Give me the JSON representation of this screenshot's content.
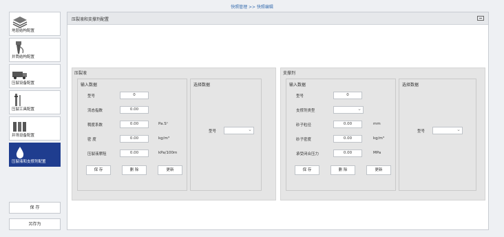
{
  "breadcrumb": "快照管理 >> 快照编辑",
  "sidebar": {
    "items": [
      {
        "label": "地层结构配置",
        "icon": "layers-icon"
      },
      {
        "label": "井筒结构配置",
        "icon": "wellbore-icon"
      },
      {
        "label": "压裂设备配置",
        "icon": "truck-icon"
      },
      {
        "label": "压裂工具配置",
        "icon": "tool-icon"
      },
      {
        "label": "井场设备配置",
        "icon": "tanks-icon"
      },
      {
        "label": "压裂液和支撑剂配置",
        "icon": "droplet-icon"
      }
    ],
    "save_label": "保 存",
    "save_as_label": "另存为"
  },
  "main": {
    "title": "压裂液和支撑剂配置"
  },
  "fluid": {
    "title": "压裂液",
    "input_title": "输入数据",
    "select_title": "选择数据",
    "rows": [
      {
        "label": "型号",
        "value": "0",
        "unit": ""
      },
      {
        "label": "流态指数",
        "value": "0.00",
        "unit": ""
      },
      {
        "label": "稠度系数",
        "value": "0.00",
        "unit": "Pa.Sⁿ"
      },
      {
        "label": "密 度",
        "value": "0.00",
        "unit": "kg/m³"
      },
      {
        "label": "压裂液摩阻",
        "value": "0.00",
        "unit": "kPa/100m"
      }
    ],
    "select_label": "型号",
    "buttons": {
      "save": "保 存",
      "delete": "删 除",
      "update": "更新"
    }
  },
  "proppant": {
    "title": "支撑剂",
    "input_title": "输入数据",
    "select_title": "选择数据",
    "rows": [
      {
        "label": "型号",
        "value": "0",
        "unit": ""
      },
      {
        "label": "支撑剂类型",
        "value": "",
        "unit": ""
      },
      {
        "label": "砂子粒径",
        "value": "0.00",
        "unit": "mm"
      },
      {
        "label": "砂子密度",
        "value": "0.00",
        "unit": "kg/m³"
      },
      {
        "label": "承受闭合压力",
        "value": "0.00",
        "unit": "MPa"
      }
    ],
    "select_label": "型号",
    "buttons": {
      "save": "保 存",
      "delete": "删 除",
      "update": "更新"
    }
  }
}
